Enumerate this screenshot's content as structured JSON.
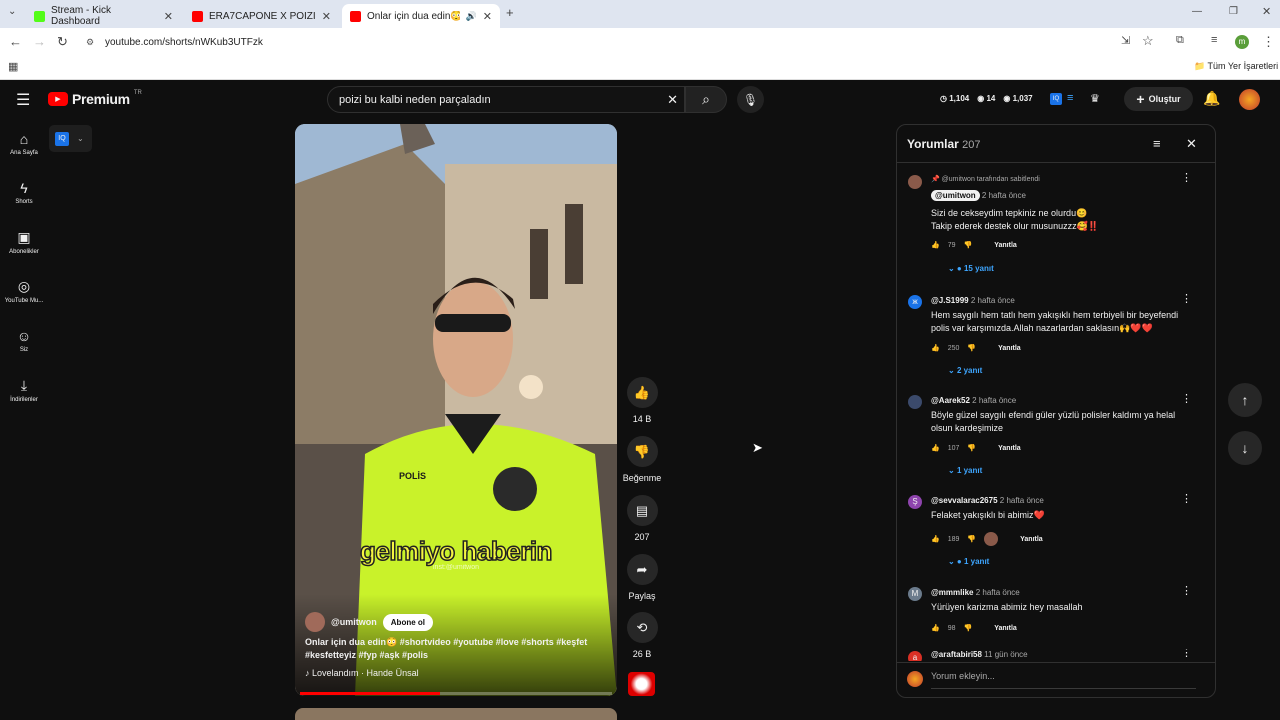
{
  "browser": {
    "tabs": [
      {
        "label": "Stream - Kick Dashboard",
        "color": "#53fc18"
      },
      {
        "label": "ERA7CAPONE X POIZI - SONBA",
        "color": "#ff0000"
      },
      {
        "label": "Onlar için dua edin😳 #sho",
        "color": "#ff0000"
      }
    ],
    "url": "youtube.com/shorts/nWKub3UTFzk",
    "bookmarks_label": "Tüm Yer İşaretleri",
    "profile_initial": "m"
  },
  "header": {
    "logo": "Premium",
    "region": "TR",
    "search_value": "poizi bu kalbi neden parçaladın",
    "stats": [
      "1,104",
      "14",
      "1,037"
    ],
    "create_label": "Oluştur"
  },
  "sidebar": {
    "items": [
      {
        "label": "Ana Sayfa",
        "icon": "home-icon"
      },
      {
        "label": "Shorts",
        "icon": "shorts-icon"
      },
      {
        "label": "Abonelikler",
        "icon": "subscriptions-icon"
      },
      {
        "label": "YouTube Mu...",
        "icon": "music-icon"
      },
      {
        "label": "Siz",
        "icon": "you-icon"
      },
      {
        "label": "İndirilenler",
        "icon": "download-icon"
      }
    ]
  },
  "video": {
    "caption": "gelmiyo haberin",
    "watermark": "inst:@umitwon",
    "channel": "@umitwon",
    "subscribe_label": "Abone ol",
    "title_line1": "Onlar için dua edin😳 #shortvideo #youtube #love #shorts #keşfet",
    "title_line2": "#kesfetteyiz #fyp #aşk #polis",
    "music": "Lovelandım · Hande Ünsal",
    "vest_text": "POLİS",
    "progress": 0.45
  },
  "actions": {
    "like_count": "14 B",
    "dislike_label": "Beğenme",
    "comment_count": "207",
    "share_label": "Paylaş",
    "remix_count": "26 B"
  },
  "comments_panel": {
    "title": "Yorumlar",
    "count": "207",
    "pinned_note": "@umitwon tarafından sabitlendi",
    "add_placeholder": "Yorum ekleyin...",
    "reply_label": "Yanıtla",
    "comments": [
      {
        "author": "@umitwon",
        "time": "2 hafta önce",
        "text": "Sizi de cekseydim tepkiniz ne olurdu😊\nTakip ederek destek olur musunuzzz🥰‼️",
        "likes": "79",
        "replies": "15 yanıt",
        "color": "#8a5a4a"
      },
      {
        "author": "@J.S1999",
        "time": "2 hafta önce",
        "text": "Hem saygılı hem tatlı hem yakışıklı hem terbiyeli bir beyefendi polis var karşımızda.Allah nazarlardan saklasın🙌❤️❤️",
        "likes": "250",
        "replies": "2 yanıt",
        "color": "#1a73e8",
        "initial": "ж"
      },
      {
        "author": "@Aarek52",
        "time": "2 hafta önce",
        "text": "Böyle güzel saygılı efendi güler yüzlü polisler kaldımı ya helal olsun kardeşimize",
        "likes": "107",
        "replies": "1 yanıt",
        "color": "#3b4a6b"
      },
      {
        "author": "@sevvalarac2675",
        "time": "2 hafta önce",
        "text": "Felaket yakışıklı bi abimiz❤️",
        "likes": "189",
        "replies": "1 yanıt",
        "color": "#8e44ad",
        "initial": "Ş"
      },
      {
        "author": "@mmmlike",
        "time": "2 hafta önce",
        "text": "Yürüyen karizma abimiz hey masallah",
        "likes": "98",
        "replies": "",
        "color": "#6b7b8c",
        "initial": "M"
      },
      {
        "author": "@araftabiri58",
        "time": "11 gün önce",
        "text": "",
        "likes": "",
        "replies": "",
        "color": "#d93025",
        "initial": "a"
      }
    ]
  }
}
